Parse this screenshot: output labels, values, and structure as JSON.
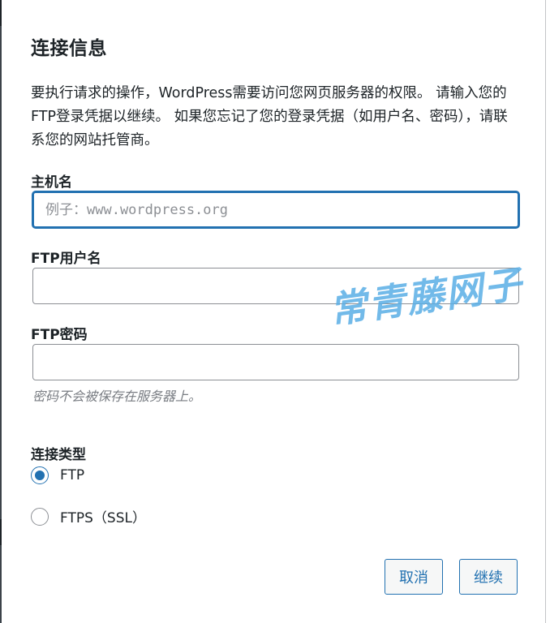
{
  "dialog": {
    "title": "连接信息",
    "intro": "要执行请求的操作，WordPress需要访问您网页服务器的权限。 请输入您的FTP登录凭据以继续。 如果您忘记了您的登录凭据（如用户名、密码），请联系您的网站托管商。"
  },
  "fields": {
    "hostname": {
      "label": "主机名",
      "placeholder": "例子：www.wordpress.org",
      "value": ""
    },
    "username": {
      "label": "FTP用户名",
      "value": ""
    },
    "password": {
      "label": "FTP密码",
      "value": "",
      "hint": "密码不会被保存在服务器上。"
    }
  },
  "connection": {
    "label": "连接类型",
    "options": [
      {
        "label": "FTP",
        "checked": true
      },
      {
        "label": "FTPS（SSL）",
        "checked": false
      }
    ]
  },
  "buttons": {
    "cancel": "取消",
    "proceed": "继续"
  },
  "watermark": "常青藤网子",
  "colors": {
    "accent": "#2271b1",
    "text": "#1d2327",
    "hint": "#787c82",
    "watermark": "#5aaee6"
  }
}
